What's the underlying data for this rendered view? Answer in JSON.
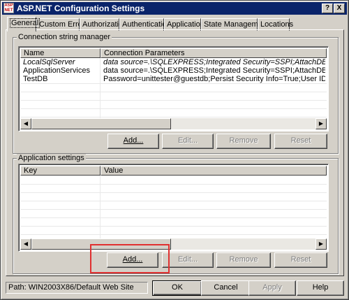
{
  "window": {
    "app_icon_text": "ASP NET",
    "title": "ASP.NET Configuration Settings",
    "help_glyph": "?",
    "close_glyph": "X"
  },
  "tabs": [
    {
      "label": "General",
      "active": true
    },
    {
      "label": "Custom Errors"
    },
    {
      "label": "Authorization"
    },
    {
      "label": "Authentication"
    },
    {
      "label": "Application"
    },
    {
      "label": "State Management"
    },
    {
      "label": "Locations"
    }
  ],
  "connection_strings": {
    "label": "Connection string manager",
    "columns": [
      "Name",
      "Connection Parameters"
    ],
    "rows": [
      {
        "name": "LocalSqlServer",
        "params": "data source=.\\SQLEXPRESS;Integrated Security=SSPI;AttachDBFilename=|DataDi",
        "italic": true
      },
      {
        "name": "ApplicationServices",
        "params": "data source=.\\SQLEXPRESS;Integrated Security=SSPI;AttachDBFilename=|DataDi"
      },
      {
        "name": "TestDB",
        "params": "Password=unittester@guestdb;Persist Security Info=True;User ID=UnitTester;Initial ..."
      }
    ],
    "buttons": {
      "add": "Add...",
      "edit": "Edit...",
      "remove": "Remove",
      "reset": "Reset"
    }
  },
  "app_settings": {
    "label": "Application settings",
    "columns": [
      "Key",
      "Value"
    ],
    "buttons": {
      "add": "Add...",
      "edit": "Edit...",
      "remove": "Remove",
      "reset": "Reset"
    }
  },
  "scroll_left": "◀",
  "scroll_right": "▶",
  "footer": {
    "path": "Path: WIN2003X86/Default Web Site",
    "ok": "OK",
    "cancel": "Cancel",
    "apply": "Apply",
    "help": "Help"
  },
  "colors": {
    "titlebar": "#0a246a",
    "highlight": "#e03030"
  }
}
